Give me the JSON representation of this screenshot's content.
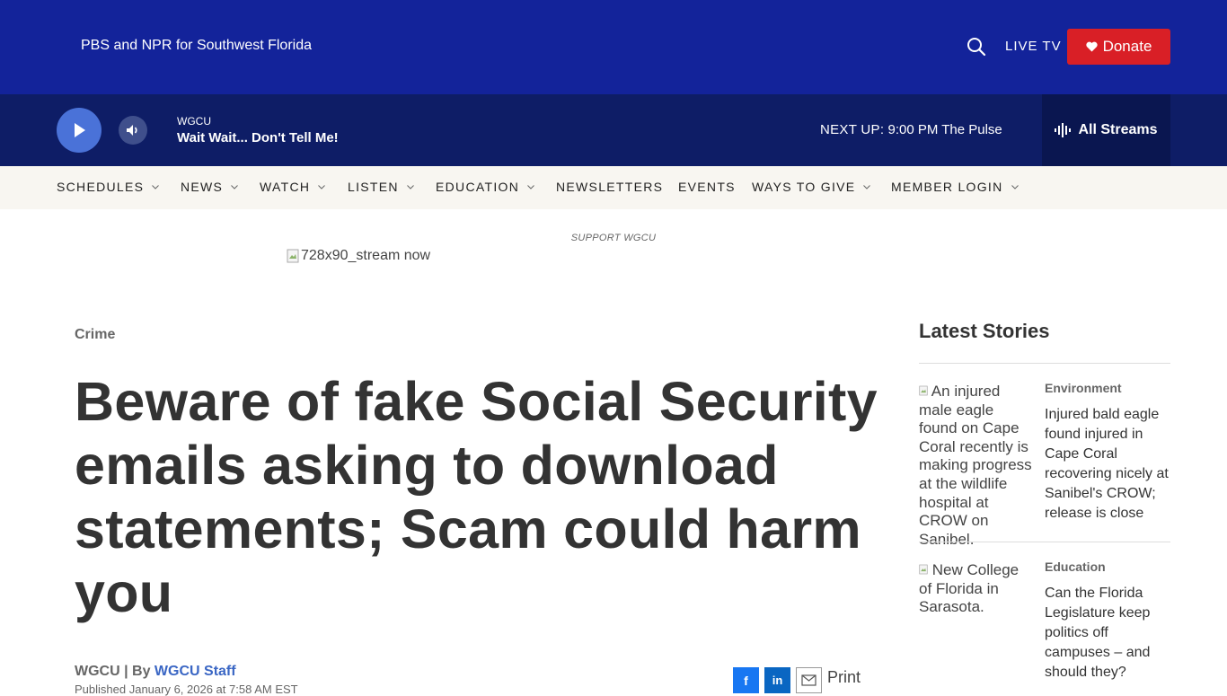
{
  "header": {
    "tagline": "PBS and NPR for Southwest Florida",
    "live_tv": "LIVE TV",
    "donate": "Donate"
  },
  "player": {
    "station": "WGCU",
    "program": "Wait Wait... Don't Tell Me!",
    "next_up_label": "NEXT UP:",
    "next_up_value": "9:00 PM The Pulse",
    "all_streams": "All Streams"
  },
  "nav": {
    "items": [
      {
        "label": "SCHEDULES"
      },
      {
        "label": "NEWS"
      },
      {
        "label": "WATCH"
      },
      {
        "label": "LISTEN"
      },
      {
        "label": "EDUCATION"
      },
      {
        "label": "NEWSLETTERS"
      },
      {
        "label": "EVENTS"
      },
      {
        "label": "WAYS TO GIVE"
      },
      {
        "label": "MEMBER LOGIN"
      }
    ]
  },
  "ad": {
    "support_label": "SUPPORT WGCU",
    "image_alt": "728x90_stream now"
  },
  "article": {
    "category": "Crime",
    "headline": "Beware of fake Social Security emails asking to download statements; Scam could harm you",
    "source": "WGCU | By ",
    "author": "WGCU Staff",
    "published": "Published January 6, 2026 at 7:58 AM EST",
    "share": {
      "facebook": "f",
      "linkedin": "in",
      "print": "Print"
    }
  },
  "sidebar": {
    "title": "Latest Stories",
    "stories": [
      {
        "image_alt": "An injured male eagle found on Cape Coral recently is making progress at the wildlife hospital at CROW on Sanibel.",
        "category": "Environment",
        "title": "Injured bald eagle found injured in Cape Coral recovering nicely at Sanibel's CROW; release is close"
      },
      {
        "image_alt": "New College of Florida in Sarasota.",
        "category": "Education",
        "title": "Can the Florida Legislature keep politics off campuses – and should they?"
      }
    ]
  },
  "colors": {
    "header_bg": "#13239a",
    "player_bg": "#0e1d66",
    "donate": "#d91f26",
    "play_button": "#4a72d8",
    "link": "#3a66c4"
  }
}
